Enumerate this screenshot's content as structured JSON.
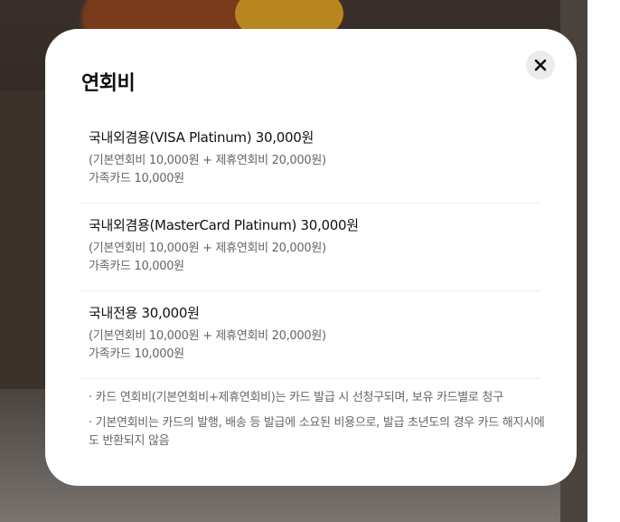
{
  "modal": {
    "title": "연회비",
    "close_icon": "close-icon"
  },
  "fees": [
    {
      "title": "국내외겸용(VISA Platinum) 30,000원",
      "breakdown": "(기본연회비 10,000원 + 제휴연회비 20,000원)",
      "family": "가족카드 10,000원"
    },
    {
      "title": "국내외겸용(MasterCard Platinum) 30,000원",
      "breakdown": "(기본연회비 10,000원 + 제휴연회비 20,000원)",
      "family": "가족카드 10,000원"
    },
    {
      "title": "국내전용 30,000원",
      "breakdown": "(기본연회비 10,000원 + 제휴연회비 20,000원)",
      "family": "가족카드 10,000원"
    }
  ],
  "notes": [
    "· 카드 연회비(기본연회비+제휴연회비)는 카드 발급 시 선청구되며, 보유 카드별로 청구",
    "· 기본연회비는 카드의 발행, 배송 등 발급에 소요된 비용으로, 발급 초년도의 경우 카드 해지시에도 반환되지 않음"
  ],
  "colors": {
    "title": "#111111",
    "secondary_text": "#666666",
    "divider": "#ededed",
    "close_bg": "#ececec"
  }
}
